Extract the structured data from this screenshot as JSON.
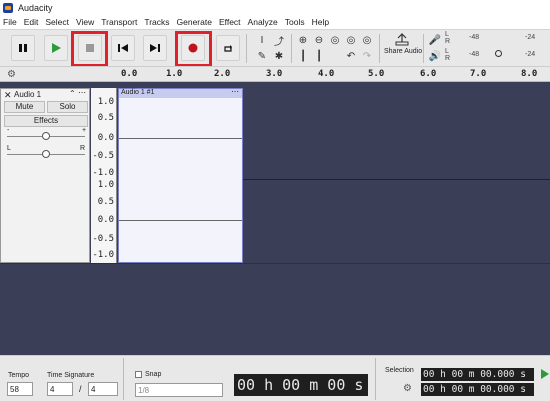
{
  "app": {
    "title": "Audacity"
  },
  "menu": [
    "File",
    "Edit",
    "Select",
    "View",
    "Transport",
    "Tracks",
    "Generate",
    "Effect",
    "Analyze",
    "Tools",
    "Help"
  ],
  "toolbar": {
    "share_label": "Share Audio",
    "meter_record": {
      "L": "L",
      "R": "R",
      "tick_a": "-48",
      "tick_b": "-24"
    },
    "meter_play": {
      "L": "L",
      "R": "R",
      "tick_a": "-48",
      "tick_b": "-24"
    }
  },
  "ruler": {
    "ticks": [
      "0.0",
      "1.0",
      "2.0",
      "3.0",
      "4.0",
      "5.0",
      "6.0",
      "7.0",
      "8.0"
    ]
  },
  "track": {
    "name": "Audio 1",
    "mute": "Mute",
    "solo": "Solo",
    "effects": "Effects",
    "gain_minus": "-",
    "gain_plus": "+",
    "pan_left": "L",
    "pan_right": "R",
    "clip_name": "Audio 1 #1",
    "vscale": [
      "1.0",
      "0.5",
      "0.0",
      "-0.5",
      "-1.0",
      "1.0",
      "0.5",
      "0.0",
      "-0.5",
      "-1.0"
    ]
  },
  "bottom": {
    "tempo_label": "Tempo",
    "tempo_value": "58",
    "timesig_label": "Time Signature",
    "timesig_num": "4",
    "timesig_slash": "/",
    "timesig_den": "4",
    "snap_label": "Snap",
    "snap_value": "1/8",
    "time_display": "00 h 00 m 00 s",
    "selection_label": "Selection",
    "sel_start": "00 h 00 m 00.000 s",
    "sel_end": "00 h 00 m 00.000 s"
  },
  "colors": {
    "highlight": "#e0202a",
    "track_bg": "#3a3f57",
    "clip_bg": "#f3f4fb",
    "clip_border": "#7b80c8"
  }
}
